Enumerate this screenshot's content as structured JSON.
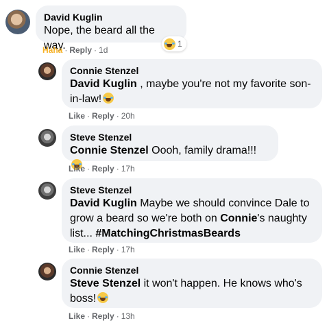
{
  "comments": [
    {
      "author": "David Kuglin",
      "text": "Nope, the beard all the way.",
      "reaction_count": "1",
      "reaction_icon": "haha-emoji",
      "action_haha": "Haha",
      "action_reply": "Reply",
      "time": "1d"
    },
    {
      "author": "Connie Stenzel",
      "mention": "David Kuglin",
      "text": " , maybe you're not my favorite son-in-law!",
      "action_like": "Like",
      "action_reply": "Reply",
      "time": "20h"
    },
    {
      "author": "Steve Stenzel",
      "mention": "Connie Stenzel",
      "text": " Oooh, family drama!!!",
      "action_like": "Like",
      "action_reply": "Reply",
      "time": "17h"
    },
    {
      "author": "Steve Stenzel",
      "mention": "David Kuglin",
      "text_part1": " Maybe we should convince Dale to grow a beard so we're both on ",
      "mention2": "Connie",
      "text_part2": "'s naughty list... ",
      "hashtag": "#MatchingChristmasBeards",
      "action_like": "Like",
      "action_reply": "Reply",
      "time": "17h"
    },
    {
      "author": "Connie Stenzel",
      "mention": "Steve Stenzel",
      "text": " it won't happen. He knows who's boss!",
      "action_like": "Like",
      "action_reply": "Reply",
      "time": "13h"
    }
  ],
  "colors": {
    "bubble": "#f0f2f5",
    "meta": "#65676b",
    "haha": "#f7b125"
  }
}
